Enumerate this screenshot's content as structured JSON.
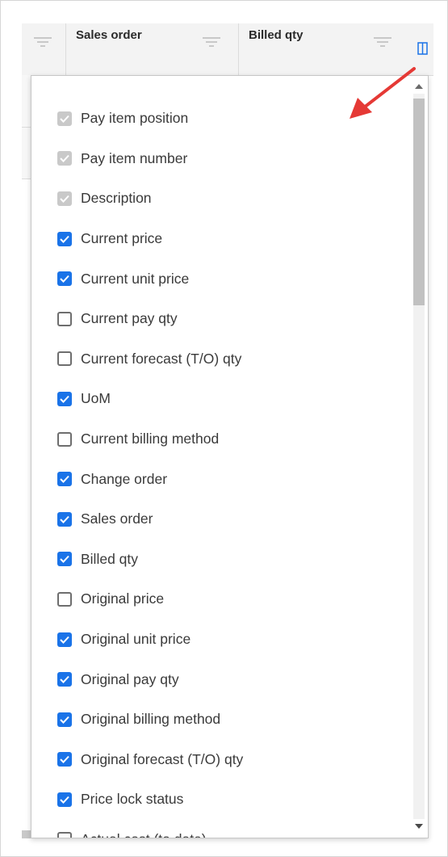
{
  "grid_header": {
    "columns": [
      "",
      "Sales order",
      "Billed qty"
    ]
  },
  "icons": {
    "filter": "filter-icon",
    "columns": "columns-icon",
    "check": "check-icon"
  },
  "colors": {
    "checked": "#1a73e8",
    "disabled": "#c9c9c9",
    "arrow": "#e53935"
  },
  "column_chooser": {
    "items": [
      {
        "label": "Pay item position",
        "state": "disabled"
      },
      {
        "label": "Pay item number",
        "state": "disabled"
      },
      {
        "label": "Description",
        "state": "disabled"
      },
      {
        "label": "Current price",
        "state": "checked"
      },
      {
        "label": "Current unit price",
        "state": "checked"
      },
      {
        "label": "Current pay qty",
        "state": "unchecked"
      },
      {
        "label": "Current forecast (T/O) qty",
        "state": "unchecked"
      },
      {
        "label": "UoM",
        "state": "checked"
      },
      {
        "label": "Current billing method",
        "state": "unchecked"
      },
      {
        "label": "Change order",
        "state": "checked"
      },
      {
        "label": "Sales order",
        "state": "checked"
      },
      {
        "label": "Billed qty",
        "state": "checked"
      },
      {
        "label": "Original price",
        "state": "unchecked"
      },
      {
        "label": "Original unit price",
        "state": "checked"
      },
      {
        "label": "Original pay qty",
        "state": "checked"
      },
      {
        "label": "Original billing method",
        "state": "checked"
      },
      {
        "label": "Original forecast (T/O) qty",
        "state": "checked"
      },
      {
        "label": "Price lock status",
        "state": "checked"
      },
      {
        "label": "Actual cost (to date)",
        "state": "unchecked"
      }
    ]
  }
}
